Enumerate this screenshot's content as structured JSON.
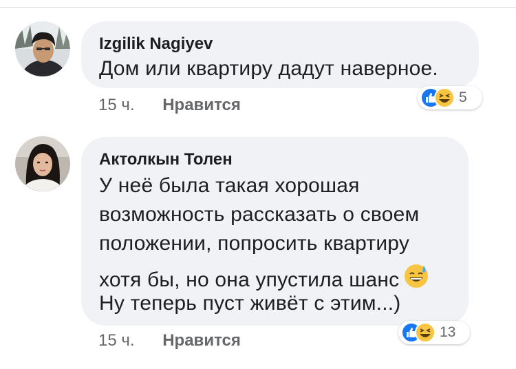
{
  "comments": [
    {
      "author": "Izgilik Nagiyev",
      "lines": [
        "Дом или квартиру дадут наверное."
      ],
      "time": "15 ч.",
      "like_label": "Нравится",
      "reaction_count": "5",
      "reactions": [
        "like-icon",
        "laugh-icon"
      ]
    },
    {
      "author": "Актолкын Толен",
      "lines": [
        "У неё была такая хорошая",
        "возможность рассказать о своем",
        "положении, попросить квартиру",
        "хотя бы, но она упустила шанс",
        "Ну теперь пуст живёт с этим...)"
      ],
      "time": "15 ч.",
      "like_label": "Нравится",
      "reaction_count": "13",
      "reactions": [
        "like-icon",
        "laugh-icon"
      ],
      "inline_emoji": "sweat-smile-icon"
    }
  ],
  "colors": {
    "bubble": "#f0f2f5",
    "like_blue": "#1877f2",
    "emoji_yellow": "#f7c542",
    "meta_gray": "#65676b"
  }
}
